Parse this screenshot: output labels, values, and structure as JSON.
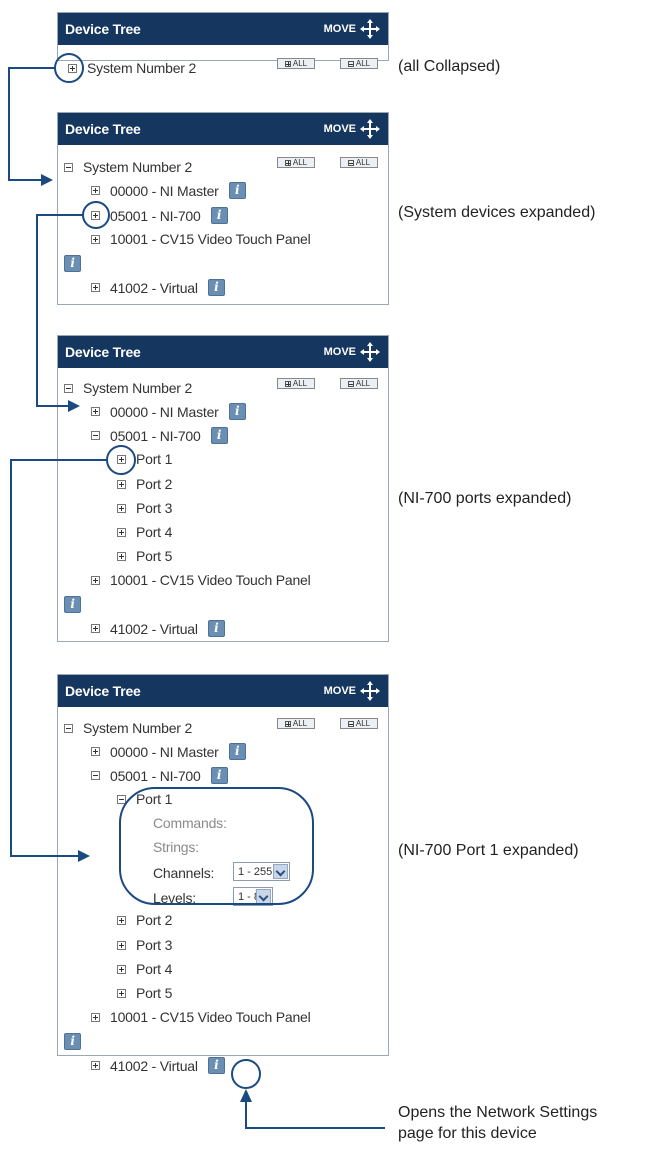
{
  "panel": {
    "title": "Device Tree",
    "move_label": "MOVE",
    "expand_all_label": "ALL",
    "collapse_all_label": "ALL"
  },
  "tree": {
    "system": "System Number 2",
    "device_1": "00000 - NI Master",
    "device_2": "05001 - NI-700",
    "device_3": "10001 - CV15 Video Touch Panel",
    "device_4": "41002 - Virtual",
    "ports": [
      "Port 1",
      "Port 2",
      "Port 3",
      "Port 4",
      "Port 5"
    ],
    "port_details": {
      "commands": "Commands:",
      "strings": "Strings:",
      "channels": "Channels:",
      "levels": "Levels:",
      "channels_value": "1 - 255",
      "levels_value": "1 - 8"
    }
  },
  "captions": {
    "collapsed": "(all Collapsed)",
    "devices_expanded": "(System devices expanded)",
    "ports_expanded": "(NI-700 ports expanded)",
    "port1_expanded": "(NI-700 Port 1 expanded)",
    "note_line1": "Opens the Network Settings",
    "note_line2": "page for this device"
  },
  "icons": {
    "info": "info-icon",
    "move": "move-arrows-icon",
    "expand": "plus-box-icon",
    "collapse": "minus-box-icon",
    "info_glyph": "i"
  },
  "colors": {
    "header": "#15365f",
    "accent": "#1b4a82",
    "info": "#6b8fb3"
  }
}
